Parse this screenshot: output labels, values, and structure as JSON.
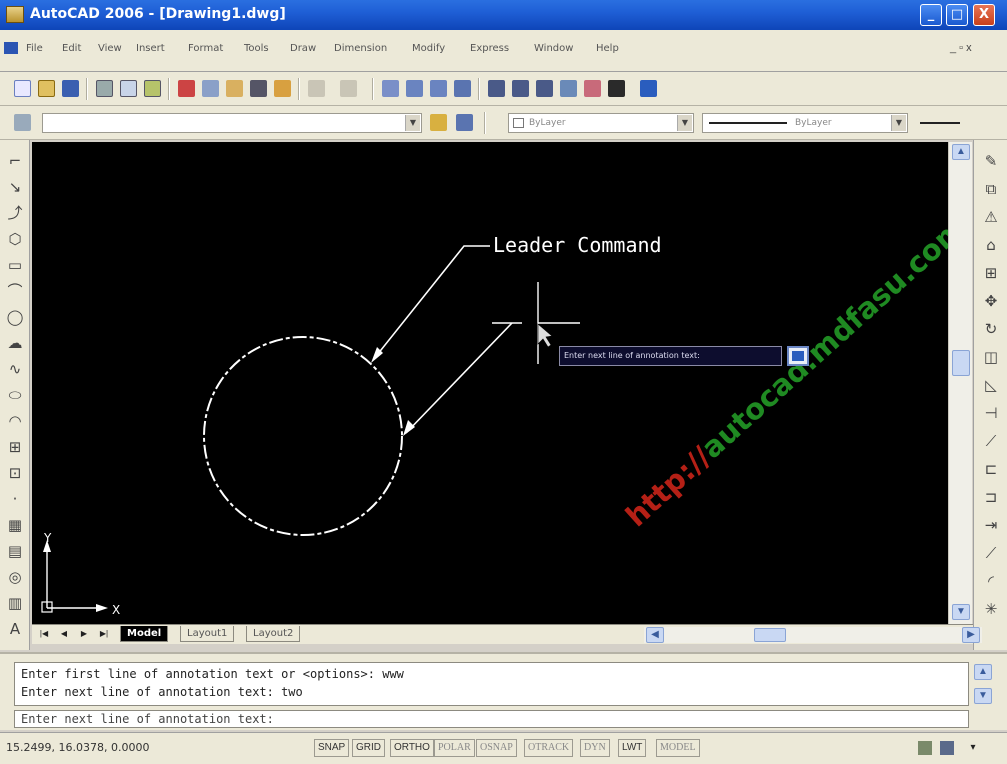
{
  "window": {
    "title": "AutoCAD 2006 - [Drawing1.dwg]",
    "buttons": {
      "minimize": "_",
      "maximize": "□",
      "close": "X"
    }
  },
  "menu": {
    "items": [
      "File",
      "Edit",
      "View",
      "Insert",
      "Format",
      "Tools",
      "Draw",
      "Dimension",
      "Modify",
      "Express",
      "Window",
      "Help"
    ],
    "doc_controls": "_ ▫ x"
  },
  "layers_toolbar": {
    "color_combo": "ByLayer",
    "linetype_combo": "ByLayer"
  },
  "drawing": {
    "leader_text": "Leader Command",
    "tooltip_prompt": "Enter next line of annotation text:",
    "ucs_x": "X",
    "ucs_y": "Y"
  },
  "watermark": {
    "part1": "http://",
    "part2": "autocad.mdfasu.com"
  },
  "colors": {
    "canvas": "#000000",
    "geometry": "#ffffff",
    "watermark_red": "#b52016",
    "watermark_green": "#1f8a22",
    "titlebar": "#1f5fd6"
  },
  "tabs": {
    "items": [
      "Model",
      "Layout1",
      "Layout2"
    ],
    "active": "Model"
  },
  "command": {
    "history": [
      "Enter first line of annotation text or <options>: www",
      "Enter next line of annotation text: two"
    ],
    "current": "Enter next line of annotation text:"
  },
  "status": {
    "coordinates": "15.2499, 16.0378, 0.0000",
    "toggles": [
      "SNAP",
      "GRID",
      "ORTHO",
      "POLAR",
      "OSNAP",
      "OTRACK",
      "DYN",
      "LWT",
      "MODEL"
    ]
  }
}
